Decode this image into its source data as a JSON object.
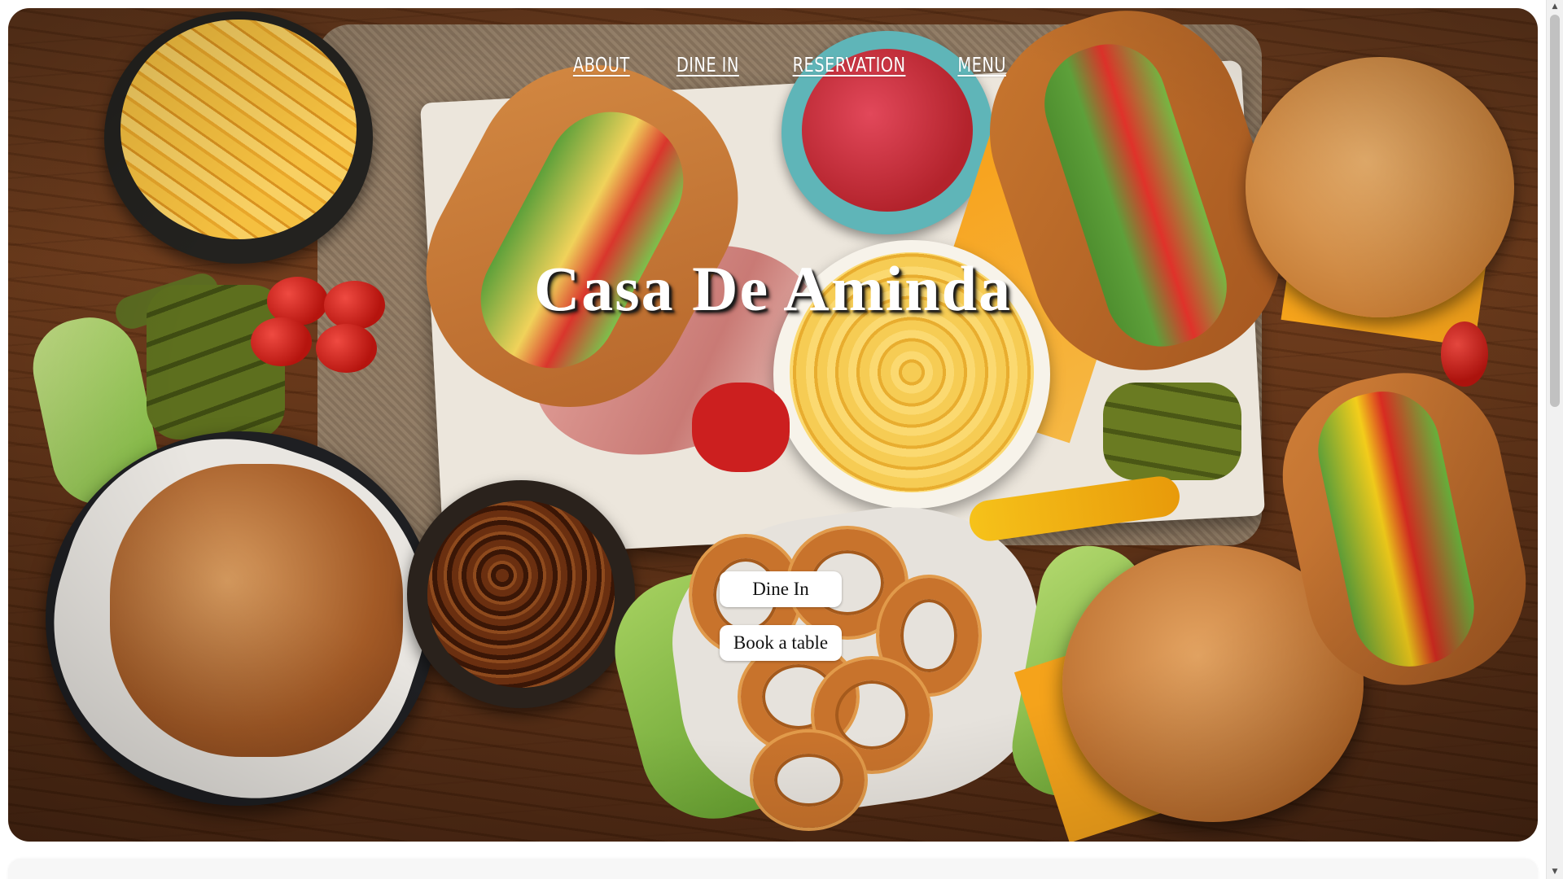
{
  "nav": {
    "items": [
      {
        "label": "ABOUT"
      },
      {
        "label": "DINE IN"
      },
      {
        "label": "RESERVATION"
      },
      {
        "label": "MENU"
      }
    ]
  },
  "hero": {
    "title": "Casa De Aminda",
    "background": "food-spread-photo",
    "buttons": {
      "dine_in": "Dine In",
      "book_table": "Book a table"
    }
  },
  "scrollbar": {
    "up_icon": "▲",
    "down_icon": "▼"
  },
  "colors": {
    "nav_text": "#ffffff",
    "title_text": "#ffffff",
    "button_bg": "#ffffff",
    "wood": "#6e3a19"
  }
}
